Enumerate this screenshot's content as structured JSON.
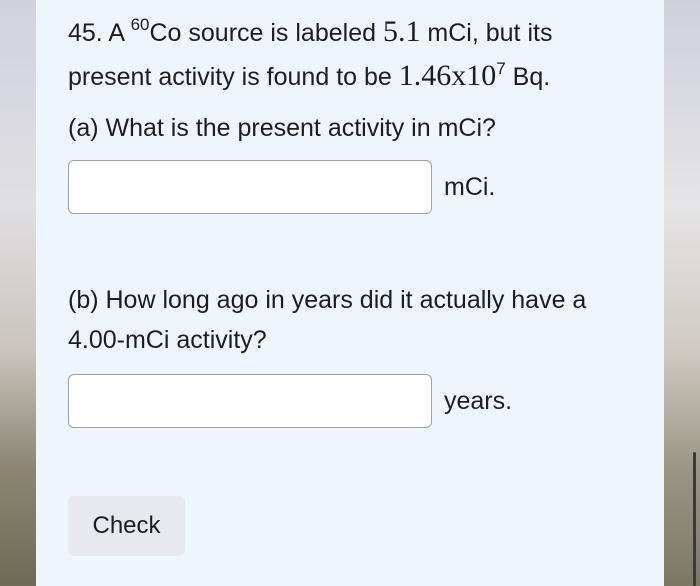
{
  "question": {
    "prefix": "45. A ",
    "isotope_mass": "60",
    "isotope_symbol": "Co",
    "text_1": " source is labeled ",
    "label_value": "5.1",
    "text_2": " mCi, but its present activity is found to be ",
    "activity_value": "1.46x10",
    "activity_exp": "7",
    "text_3": " Bq."
  },
  "part_a": {
    "prompt": "(a) What is the present activity in mCi?",
    "unit": "mCi.",
    "value": ""
  },
  "part_b": {
    "prompt": "(b) How long ago in years did it actually have a 4.00-mCi activity?",
    "unit": "years.",
    "value": ""
  },
  "check_button": {
    "label": "Check"
  },
  "colors": {
    "card_background": "#eef6fb",
    "text": "#1d1d1f",
    "button_background": "#e6e9ee",
    "input_border": "#9b9fa6"
  }
}
